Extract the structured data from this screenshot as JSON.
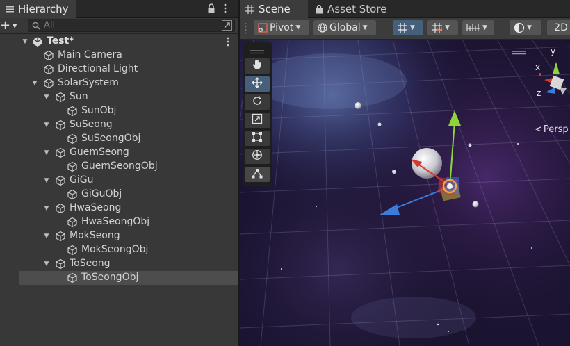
{
  "hierarchy": {
    "tab_label": "Hierarchy",
    "add_label": "+",
    "search": {
      "placeholder": "All"
    },
    "scene_name": "Test*",
    "items": [
      {
        "label": "Main Camera",
        "depth": 2,
        "expandable": false,
        "selected": false
      },
      {
        "label": "Directional Light",
        "depth": 2,
        "expandable": false,
        "selected": false
      },
      {
        "label": "SolarSystem",
        "depth": 2,
        "expandable": true,
        "selected": false
      },
      {
        "label": "Sun",
        "depth": 3,
        "expandable": true,
        "selected": false
      },
      {
        "label": "SunObj",
        "depth": 4,
        "expandable": false,
        "selected": false
      },
      {
        "label": "SuSeong",
        "depth": 3,
        "expandable": true,
        "selected": false
      },
      {
        "label": "SuSeongObj",
        "depth": 4,
        "expandable": false,
        "selected": false
      },
      {
        "label": "GuemSeong",
        "depth": 3,
        "expandable": true,
        "selected": false
      },
      {
        "label": "GuemSeongObj",
        "depth": 4,
        "expandable": false,
        "selected": false
      },
      {
        "label": "GiGu",
        "depth": 3,
        "expandable": true,
        "selected": false
      },
      {
        "label": "GiGuObj",
        "depth": 4,
        "expandable": false,
        "selected": false
      },
      {
        "label": "HwaSeong",
        "depth": 3,
        "expandable": true,
        "selected": false
      },
      {
        "label": "HwaSeongObj",
        "depth": 4,
        "expandable": false,
        "selected": false
      },
      {
        "label": "MokSeong",
        "depth": 3,
        "expandable": true,
        "selected": false
      },
      {
        "label": "MokSeongObj",
        "depth": 4,
        "expandable": false,
        "selected": false
      },
      {
        "label": "ToSeong",
        "depth": 3,
        "expandable": true,
        "selected": false
      },
      {
        "label": "ToSeongObj",
        "depth": 4,
        "expandable": false,
        "selected": true
      }
    ]
  },
  "scene": {
    "tabs": [
      {
        "label": "Scene",
        "icon": "grid-icon",
        "active": true
      },
      {
        "label": "Asset Store",
        "icon": "bag-icon",
        "active": false
      }
    ],
    "toolbar": {
      "pivot_label": "Pivot",
      "global_label": "Global",
      "mode_2d_label": "2D"
    },
    "gizmo": {
      "axis_y": "y",
      "axis_x": "x",
      "axis_z": "z",
      "projection_label": "Persp"
    },
    "tools": [
      "hand-tool",
      "move-tool",
      "rotate-tool",
      "scale-tool",
      "rect-tool",
      "transform-tool",
      "custom-tool"
    ],
    "active_tool": "move-tool"
  },
  "colors": {
    "accent_blue": "#46607c",
    "gizmo_y": "#8fd43a",
    "gizmo_x": "#d8392e",
    "gizmo_z": "#3a7bdc"
  }
}
